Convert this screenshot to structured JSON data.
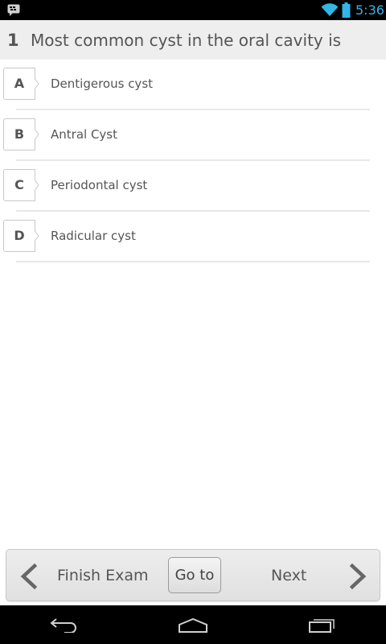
{
  "status_bar": {
    "time": "5:36",
    "icons": [
      "blackberry-messenger-icon",
      "wifi-icon",
      "battery-icon"
    ]
  },
  "question": {
    "number": "1",
    "text": "Most common cyst in the oral cavity is"
  },
  "options": [
    {
      "letter": "A",
      "text": "Dentigerous cyst"
    },
    {
      "letter": "B",
      "text": "Antral Cyst"
    },
    {
      "letter": "C",
      "text": "Periodontal cyst"
    },
    {
      "letter": "D",
      "text": "Radicular cyst"
    }
  ],
  "toolbar": {
    "finish_label": "Finish Exam",
    "goto_label": "Go to",
    "next_label": "Next"
  },
  "colors": {
    "accent": "#33b5e5",
    "header_bg": "#eeeeee",
    "text": "#555555"
  }
}
